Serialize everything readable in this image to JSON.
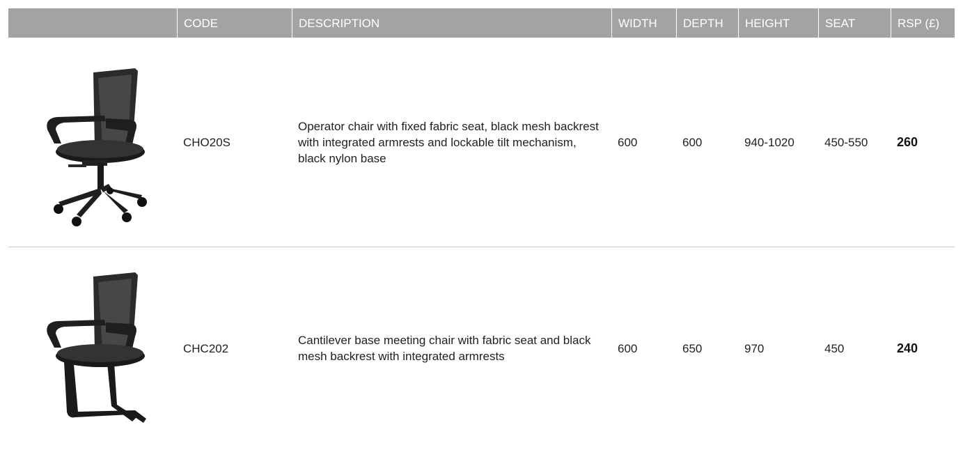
{
  "header": {
    "image": "",
    "code": "CODE",
    "description": "DESCRIPTION",
    "width": "WIDTH",
    "depth": "DEPTH",
    "height": "HEIGHT",
    "seat": "SEAT",
    "rsp": "RSP (£)"
  },
  "rows": [
    {
      "image_icon": "operator-chair-image",
      "code": "CHO20S",
      "description": "Operator chair with fixed fabric seat, black mesh backrest with integrated armrests and lockable tilt mechanism, black nylon base",
      "width": "600",
      "depth": "600",
      "height": "940-1020",
      "seat": "450-550",
      "rsp": "260"
    },
    {
      "image_icon": "cantilever-chair-image",
      "code": "CHC202",
      "description": "Cantilever base meeting chair with fabric seat and black mesh backrest with integrated armrests",
      "width": "600",
      "depth": "650",
      "height": "970",
      "seat": "450",
      "rsp": "240"
    }
  ],
  "colors": {
    "header_bg": "#a3a3a3",
    "header_text": "#ffffff",
    "divider": "#c9c9c9"
  }
}
